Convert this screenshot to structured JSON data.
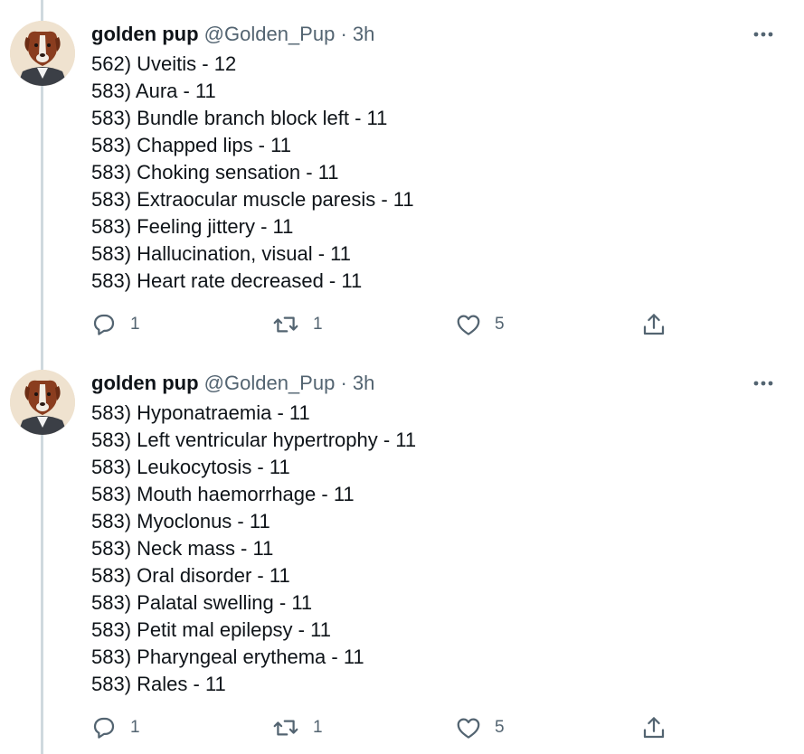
{
  "tweets": [
    {
      "author": {
        "name": "golden pup",
        "handle": "@Golden_Pup",
        "separator": "·",
        "time": "3h"
      },
      "lines": [
        "562) Uveitis - 12",
        "583) Aura - 11",
        "583) Bundle branch block left - 11",
        "583) Chapped lips - 11",
        "583) Choking sensation - 11",
        "583) Extraocular muscle paresis - 11",
        "583) Feeling jittery - 11",
        "583) Hallucination, visual - 11",
        "583) Heart rate decreased - 11"
      ],
      "actions": {
        "replies": "1",
        "retweets": "1",
        "likes": "5"
      }
    },
    {
      "author": {
        "name": "golden pup",
        "handle": "@Golden_Pup",
        "separator": "·",
        "time": "3h"
      },
      "lines": [
        "583) Hyponatraemia - 11",
        "583) Left ventricular hypertrophy - 11",
        "583) Leukocytosis - 11",
        "583) Mouth haemorrhage - 11",
        "583) Myoclonus - 11",
        "583) Neck mass - 11",
        "583) Oral disorder - 11",
        "583) Palatal swelling - 11",
        "583) Petit mal epilepsy - 11",
        "583) Pharyngeal erythema - 11",
        "583) Rales - 11"
      ],
      "actions": {
        "replies": "1",
        "retweets": "1",
        "likes": "5"
      }
    }
  ],
  "icons": {
    "reply": "reply-icon",
    "retweet": "retweet-icon",
    "like": "heart-icon",
    "share": "share-icon",
    "more": "more-icon",
    "avatar": "dog-avatar"
  },
  "colors": {
    "text": "#0f1419",
    "secondary": "#536471",
    "thread_line": "#cfd9de"
  }
}
